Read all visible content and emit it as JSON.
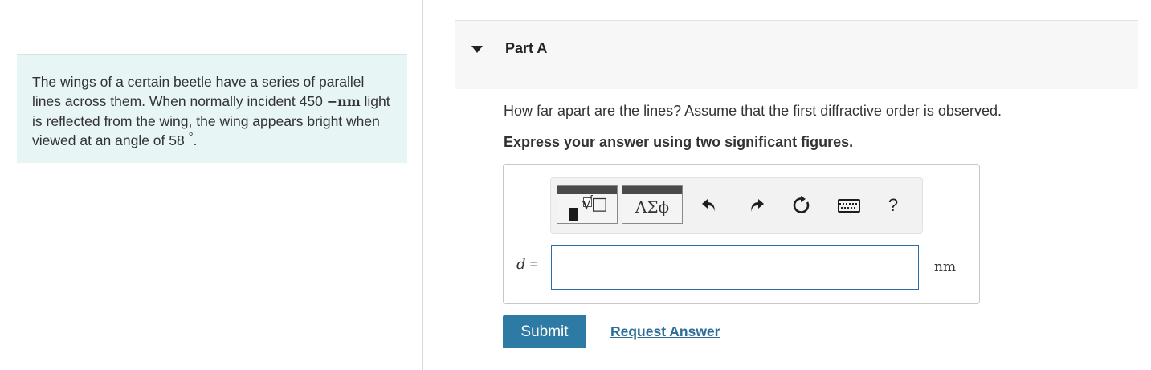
{
  "problem": {
    "text_1": "The wings of a certain beetle have a series of parallel lines across them. When normally incident 450 ",
    "dash": "−",
    "unit_nm": "nm",
    "text_2": " light is reflected from the wing, the wing appears bright when viewed at an angle of 58 ",
    "degree": "°",
    "text_3": "."
  },
  "part": {
    "title": "Part A",
    "question": "How far apart are the lines? Assume that the first diffractive order is observed.",
    "instruction": "Express your answer using two significant figures."
  },
  "toolbar": {
    "templates_icon": "fraction-sqrt-template-icon",
    "greek_label": "ΑΣϕ",
    "undo_icon": "undo-icon",
    "redo_icon": "redo-icon",
    "reset_icon": "reset-icon",
    "keyboard_icon": "keyboard-icon",
    "help_label": "?"
  },
  "answer": {
    "variable": "d",
    "equals": "=",
    "value": "",
    "unit": "nm"
  },
  "actions": {
    "submit_label": "Submit",
    "request_label": "Request Answer"
  },
  "colors": {
    "problem_bg": "#e8f5f5",
    "submit_bg": "#2d7aa4",
    "link": "#2c6e99",
    "input_border": "#2b6ea8"
  }
}
